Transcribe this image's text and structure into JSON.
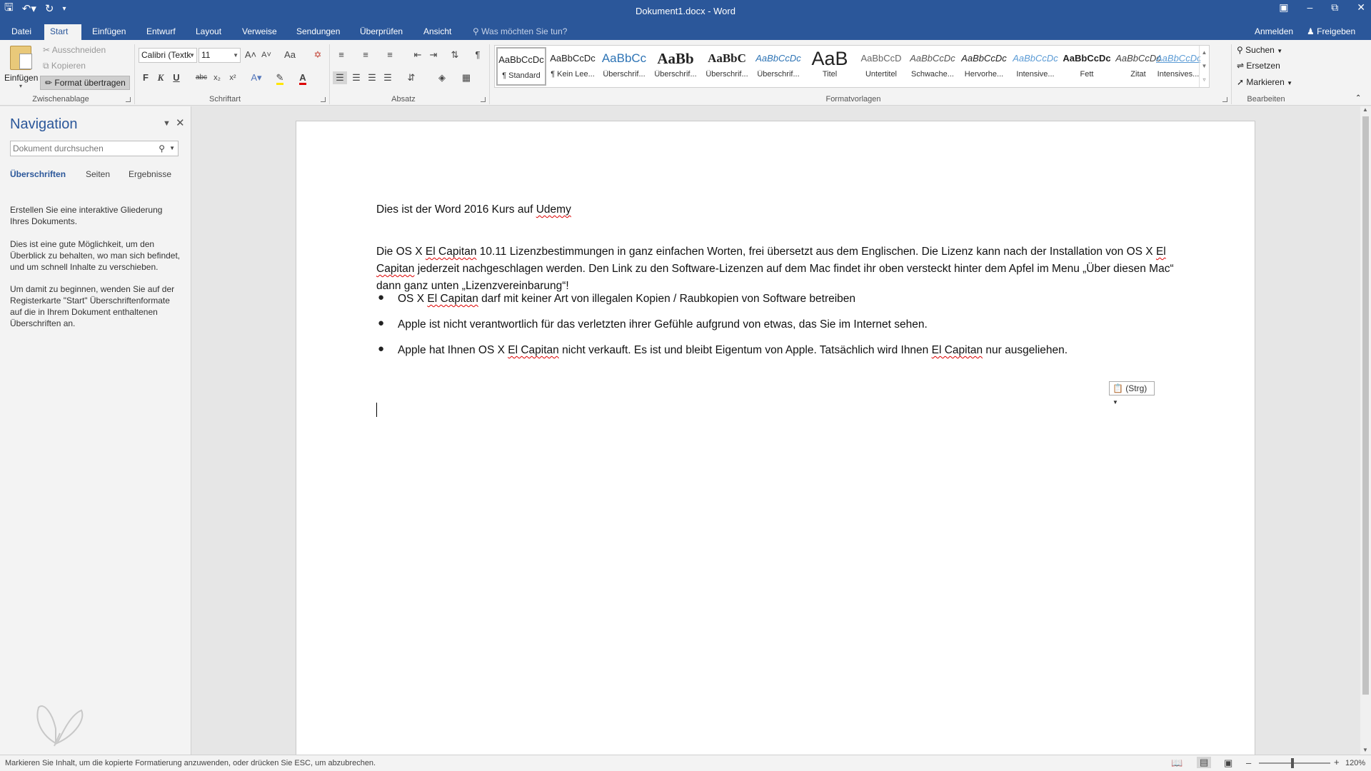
{
  "window": {
    "title": "Dokument1.docx - Word",
    "qat_icons": [
      "save-icon",
      "undo-icon",
      "redo-icon",
      "customize-qat-icon"
    ],
    "controls": [
      "ribbon-display-icon",
      "minimize-icon",
      "restore-icon",
      "close-icon"
    ]
  },
  "tabs": [
    "Datei",
    "Start",
    "Einfügen",
    "Entwurf",
    "Layout",
    "Verweise",
    "Sendungen",
    "Überprüfen",
    "Ansicht"
  ],
  "active_tab": "Start",
  "tell_me": "Was möchten Sie tun?",
  "account": {
    "signin": "Anmelden",
    "share": "Freigeben"
  },
  "ribbon": {
    "clipboard": {
      "label": "Zwischenablage",
      "paste": "Einfügen",
      "cut": "Ausschneiden",
      "copy": "Kopieren",
      "format_painter": "Format übertragen"
    },
    "font": {
      "label": "Schriftart",
      "font_name": "Calibri (Textk",
      "font_size": "11",
      "bold": "F",
      "italic": "K",
      "underline": "U",
      "strike": "abc",
      "subscript": "x₂",
      "superscript": "x²",
      "grow": "A˄",
      "shrink": "A˅",
      "case": "Aa"
    },
    "paragraph": {
      "label": "Absatz"
    },
    "styles": {
      "label": "Formatvorlagen",
      "items": [
        {
          "preview": "AaBbCcDc",
          "name": "¶ Standard"
        },
        {
          "preview": "AaBbCcDc",
          "name": "¶ Kein Lee..."
        },
        {
          "preview": "AaBbCc",
          "name": "Überschrif..."
        },
        {
          "preview": "AaBb",
          "name": "Überschrif..."
        },
        {
          "preview": "AaBbC",
          "name": "Überschrif..."
        },
        {
          "preview": "AaBbCcDc",
          "name": "Überschrif..."
        },
        {
          "preview": "AaB",
          "name": "Titel"
        },
        {
          "preview": "AaBbCcD",
          "name": "Untertitel"
        },
        {
          "preview": "AaBbCcDc",
          "name": "Schwache..."
        },
        {
          "preview": "AaBbCcDc",
          "name": "Hervorhe..."
        },
        {
          "preview": "AaBbCcDc",
          "name": "Intensive..."
        },
        {
          "preview": "AaBbCcDc",
          "name": "Fett"
        },
        {
          "preview": "AaBbCcDc",
          "name": "Zitat"
        },
        {
          "preview": "AaBbCcDc",
          "name": "Intensives..."
        }
      ]
    },
    "editing": {
      "label": "Bearbeiten",
      "find": "Suchen",
      "replace": "Ersetzen",
      "select": "Markieren"
    }
  },
  "navigation": {
    "title": "Navigation",
    "search_placeholder": "Dokument durchsuchen",
    "tabs": [
      "Überschriften",
      "Seiten",
      "Ergebnisse"
    ],
    "active_tab": "Überschriften",
    "help": [
      "Erstellen Sie eine interaktive Gliederung Ihres Dokuments.",
      "Dies ist eine gute Möglichkeit, um den Überblick zu behalten, wo man sich befindet, und um schnell Inhalte zu verschieben.",
      "Um damit zu beginnen, wenden Sie auf der Registerkarte \"Start\" Überschriftenformate auf die in Ihrem Dokument enthaltenen Überschriften an."
    ]
  },
  "document": {
    "heading_line": "Dies ist der Word 2016 Kurs auf ",
    "heading_link": "Udemy",
    "paragraph": [
      "Die OS X ",
      "El Capitan",
      " 10.11 Lizenzbestimmungen in ganz einfachen Worten, frei übersetzt aus dem Englischen. Die Lizenz kann nach der Installation von OS X ",
      "El Capitan",
      " jederzeit nachgeschlagen werden. Den Link zu den Software-Lizenzen auf dem Mac findet ihr oben versteckt hinter dem Apfel im Menu „Über diesen Mac“ dann ganz unten „Lizenzvereinbarung“!"
    ],
    "bullets": [
      [
        "OS X ",
        "El Capitan",
        " darf mit keiner Art von illegalen Kopien / Raubkopien von Software betreiben"
      ],
      [
        "Apple ist nicht verantwortlich für das verletzten ihrer Gefühle aufgrund von etwas, das Sie im Internet sehen."
      ],
      [
        "Apple hat Ihnen OS X ",
        "El Capitan",
        " nicht verkauft. Es ist und bleibt Eigentum von Apple. Tatsächlich wird Ihnen ",
        "El Capitan",
        " nur ausgeliehen."
      ]
    ],
    "paste_options": "(Strg)"
  },
  "status": {
    "message": "Markieren Sie Inhalt, um die kopierte Formatierung anzuwenden, oder drücken Sie ESC, um abzubrechen.",
    "zoom": "120%"
  }
}
